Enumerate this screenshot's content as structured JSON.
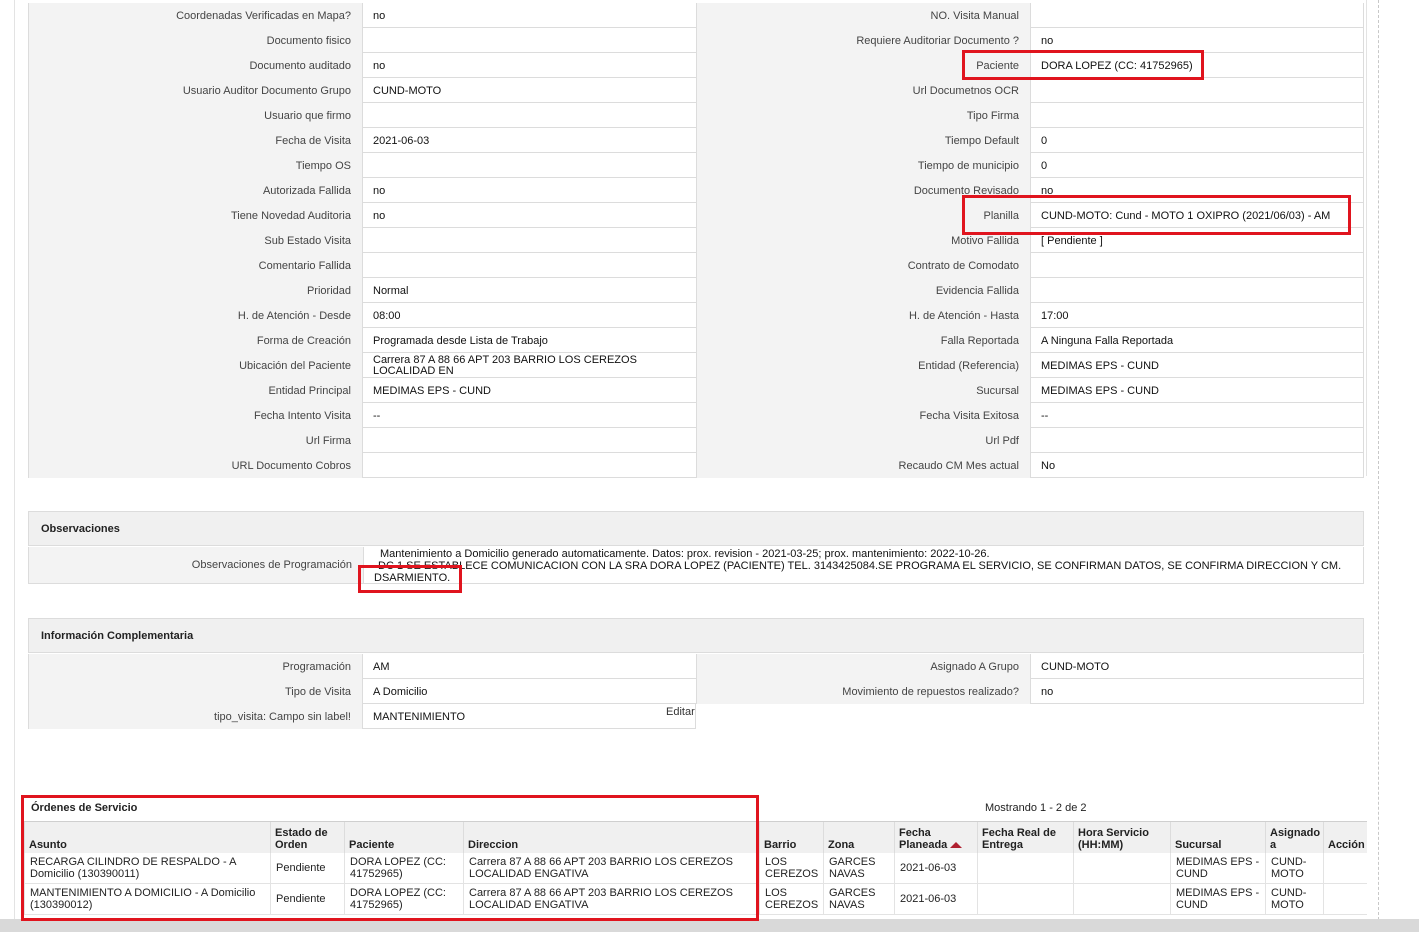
{
  "details": [
    {
      "l1": "Coordenadas Verificadas en Mapa?",
      "v1": "no",
      "l2": "NO. Visita Manual",
      "v2": ""
    },
    {
      "l1": "Documento fisico",
      "v1": "",
      "l2": "Requiere Auditoriar Documento ?",
      "v2": "no"
    },
    {
      "l1": "Documento auditado",
      "v1": "no",
      "l2": "Paciente",
      "v2": "DORA LOPEZ (CC: 41752965)"
    },
    {
      "l1": "Usuario Auditor Documento Grupo",
      "v1": "CUND-MOTO",
      "l2": "Url Documetnos OCR",
      "v2": ""
    },
    {
      "l1": "Usuario que firmo",
      "v1": "",
      "l2": "Tipo Firma",
      "v2": ""
    },
    {
      "l1": "Fecha de Visita",
      "v1": "2021-06-03",
      "l2": "Tiempo Default",
      "v2": "0"
    },
    {
      "l1": "Tiempo OS",
      "v1": "",
      "l2": "Tiempo de municipio",
      "v2": "0"
    },
    {
      "l1": "Autorizada Fallida",
      "v1": "no",
      "l2": "Documento Revisado",
      "v2": "no"
    },
    {
      "l1": "Tiene Novedad Auditoria",
      "v1": "no",
      "l2": "Planilla",
      "v2": "CUND-MOTO: Cund - MOTO 1 OXIPRO (2021/06/03) - AM"
    },
    {
      "l1": "Sub Estado Visita",
      "v1": "",
      "l2": "Motivo Fallida",
      "v2": "[ Pendiente ]"
    },
    {
      "l1": "Comentario Fallida",
      "v1": "",
      "l2": "Contrato de Comodato",
      "v2": ""
    },
    {
      "l1": "Prioridad",
      "v1": "Normal",
      "l2": "Evidencia Fallida",
      "v2": ""
    },
    {
      "l1": "H. de Atención - Desde",
      "v1": "08:00",
      "l2": "H. de Atención - Hasta",
      "v2": "17:00"
    },
    {
      "l1": "Forma de Creación",
      "v1": "Programada desde Lista de Trabajo",
      "l2": "Falla Reportada",
      "v2": "A Ninguna Falla Reportada"
    },
    {
      "l1": "Ubicación del Paciente",
      "v1": "Carrera 87 A 88 66 APT 203 BARRIO LOS CEREZOS LOCALIDAD EN",
      "l2": "Entidad (Referencia)",
      "v2": "MEDIMAS EPS - CUND"
    },
    {
      "l1": "Entidad Principal",
      "v1": "MEDIMAS EPS - CUND",
      "l2": "Sucursal",
      "v2": "MEDIMAS EPS - CUND"
    },
    {
      "l1": "Fecha Intento Visita",
      "v1": "--",
      "l2": "Fecha Visita Exitosa",
      "v2": "--"
    },
    {
      "l1": "Url Firma",
      "v1": "",
      "l2": "Url Pdf",
      "v2": ""
    },
    {
      "l1": "URL Documento Cobros",
      "v1": "",
      "l2": "Recaudo CM Mes actual",
      "v2": "No"
    }
  ],
  "observaciones": {
    "title": "Observaciones",
    "label": "Observaciones de Programación",
    "line1": "Mantenimiento a Domicilio generado automaticamente. Datos: prox. revision - 2021-03-25; prox. mantenimiento: 2022-10-26.",
    "line2": "DC 1 SE ESTABLECE COMUNICACION CON LA SRA DORA LOPEZ (PACIENTE) TEL. 3143425084.SE PROGRAMA EL SERVICIO, SE CONFIRMAN DATOS, SE CONFIRMA DIRECCION Y CM.",
    "line3": "DSARMIENTO."
  },
  "complementaria": {
    "title": "Información Complementaria",
    "rows": [
      {
        "l1": "Programación",
        "v1": "AM",
        "l2": "Asignado A Grupo",
        "v2": "CUND-MOTO"
      },
      {
        "l1": "Tipo de Visita",
        "v1": "A Domicilio",
        "l2": "Movimiento de repuestos realizado?",
        "v2": "no"
      },
      {
        "l1": "tipo_visita: Campo sin label!",
        "v1": "MANTENIMIENTO"
      }
    ],
    "edit_label": "Editar"
  },
  "ordenes": {
    "title": "Órdenes de Servicio",
    "showing": "Mostrando 1 - 2 de 2",
    "columns": [
      "Asunto",
      "Estado de Orden",
      "Paciente",
      "Direccion",
      "Barrio",
      "Zona",
      "Fecha Planeada",
      "Fecha Real de Entrega",
      "Hora Servicio (HH:MM)",
      "Sucursal",
      "Asignado a",
      "Acción"
    ],
    "rows": [
      {
        "asunto": "RECARGA CILINDRO DE RESPALDO - A Domicilio (130390011)",
        "estado": "Pendiente",
        "paciente": "DORA LOPEZ (CC: 41752965)",
        "direccion": "Carrera 87 A 88 66 APT 203 BARRIO LOS CEREZOS LOCALIDAD ENGATIVA",
        "barrio": "LOS CEREZOS",
        "zona": "GARCES NAVAS",
        "fecha_planeada": "2021-06-03",
        "fecha_real": "",
        "hora": "",
        "sucursal": "MEDIMAS EPS - CUND",
        "asignado": "CUND-MOTO",
        "accion": ""
      },
      {
        "asunto": "MANTENIMIENTO A DOMICILIO - A Domicilio (130390012)",
        "estado": "Pendiente",
        "paciente": "DORA LOPEZ (CC: 41752965)",
        "direccion": "Carrera 87 A 88 66 APT 203 BARRIO LOS CEREZOS LOCALIDAD ENGATIVA",
        "barrio": "LOS CEREZOS",
        "zona": "GARCES NAVAS",
        "fecha_planeada": "2021-06-03",
        "fecha_real": "",
        "hora": "",
        "sucursal": "MEDIMAS EPS - CUND",
        "asignado": "CUND-MOTO",
        "accion": ""
      }
    ]
  },
  "colors": {
    "highlight": "#e0141e",
    "sort_arrow": "#b02030"
  }
}
